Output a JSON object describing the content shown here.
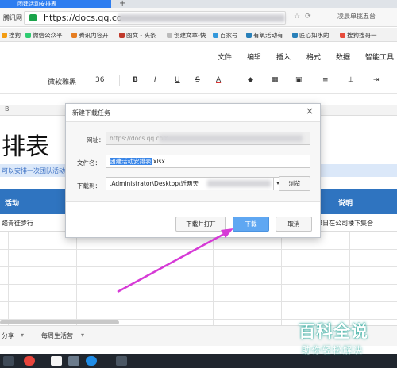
{
  "browser": {
    "tab_title": "团建活动安排表",
    "new_tab": "+",
    "site_label": "腾讯网",
    "url_visible": "https://docs.qq.co",
    "side_search": "凌晨单挑五台"
  },
  "bookmarks": [
    {
      "label": "搜狗",
      "color": "#f39c12"
    },
    {
      "label": "微信公众平",
      "color": "#2ecc71"
    },
    {
      "label": "腾讯内容开",
      "color": "#e67e22"
    },
    {
      "label": "图文 - 头条",
      "color": "#c0392b"
    },
    {
      "label": "创建文章-快",
      "color": "#bbbbbb"
    },
    {
      "label": "百家号",
      "color": "#3498db"
    },
    {
      "label": "有氧活动有",
      "color": "#2980b9"
    },
    {
      "label": "匠心如水的",
      "color": "#2980b9"
    },
    {
      "label": "搜狗搜哥一",
      "color": "#e74c3c"
    }
  ],
  "menu": [
    "文件",
    "编辑",
    "插入",
    "格式",
    "数据",
    "智能工具"
  ],
  "toolbar": {
    "font_name": "微软雅黑",
    "font_size": "36",
    "bold": "B",
    "italic": "I",
    "underline": "U",
    "strike": "S",
    "font_color": "A"
  },
  "sheet": {
    "column_letter": "B",
    "title": "排表",
    "note": "可以安排一次团队活动,",
    "header_activity": "活动",
    "header_note": "说明",
    "row1_activity": "踏青徒步行",
    "row1_note": "22日在公司楼下集合",
    "tabs": [
      "分享",
      "每周生活营"
    ]
  },
  "dialog": {
    "title": "新建下载任务",
    "close": "×",
    "url_label": "网址：",
    "url_value": "https://docs.qq.com",
    "filename_label": "文件名：",
    "filename_selected": "团建活动安排表",
    "filename_ext": ".xlsx",
    "saveto_label": "下载到：",
    "saveto_value": ".Administrator\\Desktop\\近两天",
    "dropdown": "▾",
    "browse_label": "浏览",
    "download_open_label": "下载并打开",
    "download_label": "下载",
    "cancel_label": "取消"
  },
  "watermark": {
    "title": "百科全说",
    "subtitle": "助你轻松解决"
  },
  "colors": {
    "accent": "#2f74c0",
    "primary_button": "#5fa7f2",
    "arrow": "#d63ad6"
  }
}
